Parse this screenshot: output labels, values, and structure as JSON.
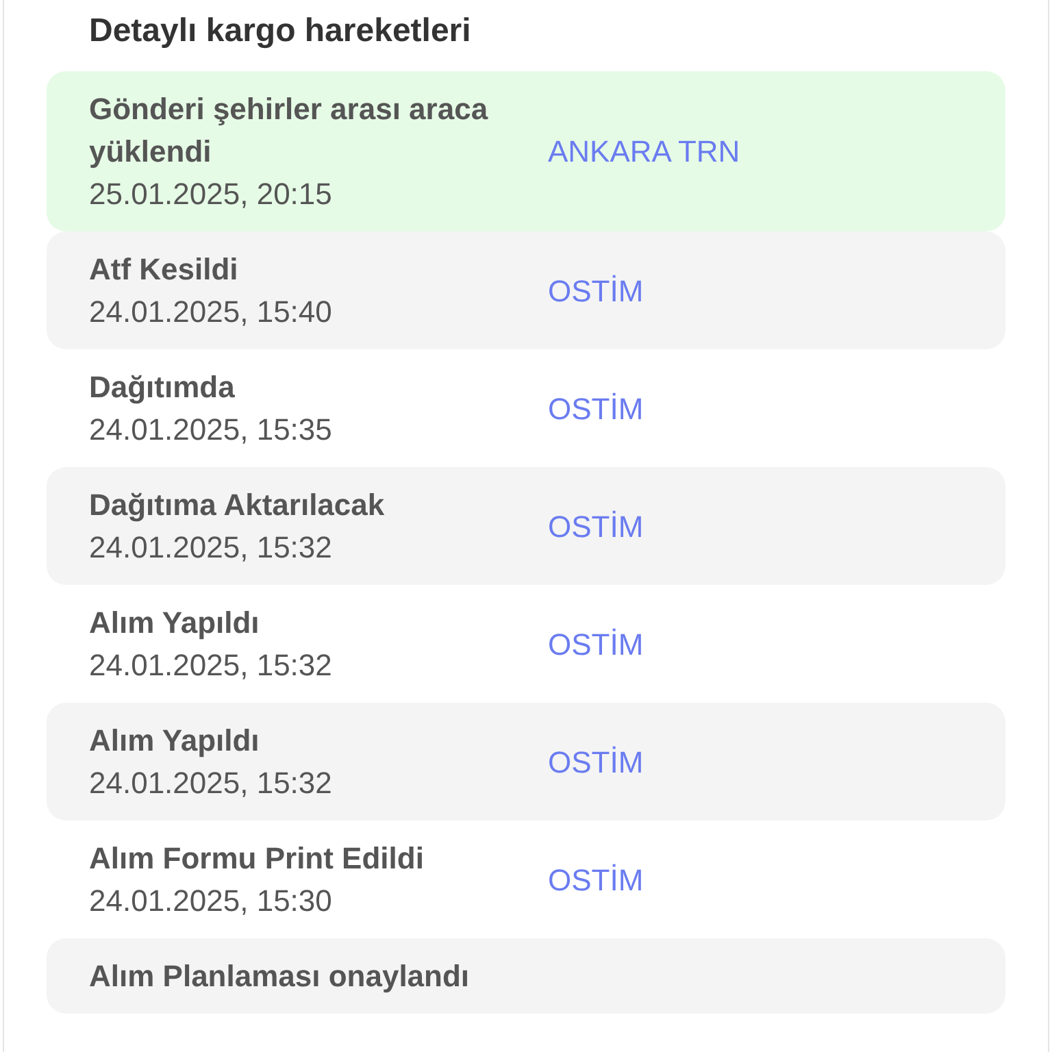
{
  "heading": "Detaylı kargo hareketleri",
  "events": [
    {
      "kind": "current",
      "status": "Gönderi şehirler arası araca yüklendi",
      "time": "25.01.2025, 20:15",
      "location": "ANKARA TRN"
    },
    {
      "kind": "shaded",
      "status": "Atf Kesildi",
      "time": "24.01.2025, 15:40",
      "location": "OSTİM"
    },
    {
      "kind": "plain",
      "status": "Dağıtımda",
      "time": "24.01.2025, 15:35",
      "location": "OSTİM"
    },
    {
      "kind": "shaded",
      "status": "Dağıtıma Aktarılacak",
      "time": "24.01.2025, 15:32",
      "location": "OSTİM"
    },
    {
      "kind": "plain",
      "status": "Alım Yapıldı",
      "time": "24.01.2025, 15:32",
      "location": "OSTİM"
    },
    {
      "kind": "shaded",
      "status": "Alım Yapıldı",
      "time": "24.01.2025, 15:32",
      "location": "OSTİM"
    },
    {
      "kind": "plain",
      "status": "Alım Formu Print Edildi",
      "time": "24.01.2025, 15:30",
      "location": "OSTİM"
    },
    {
      "kind": "shaded",
      "status": "Alım Planlaması onaylandı"
    }
  ]
}
